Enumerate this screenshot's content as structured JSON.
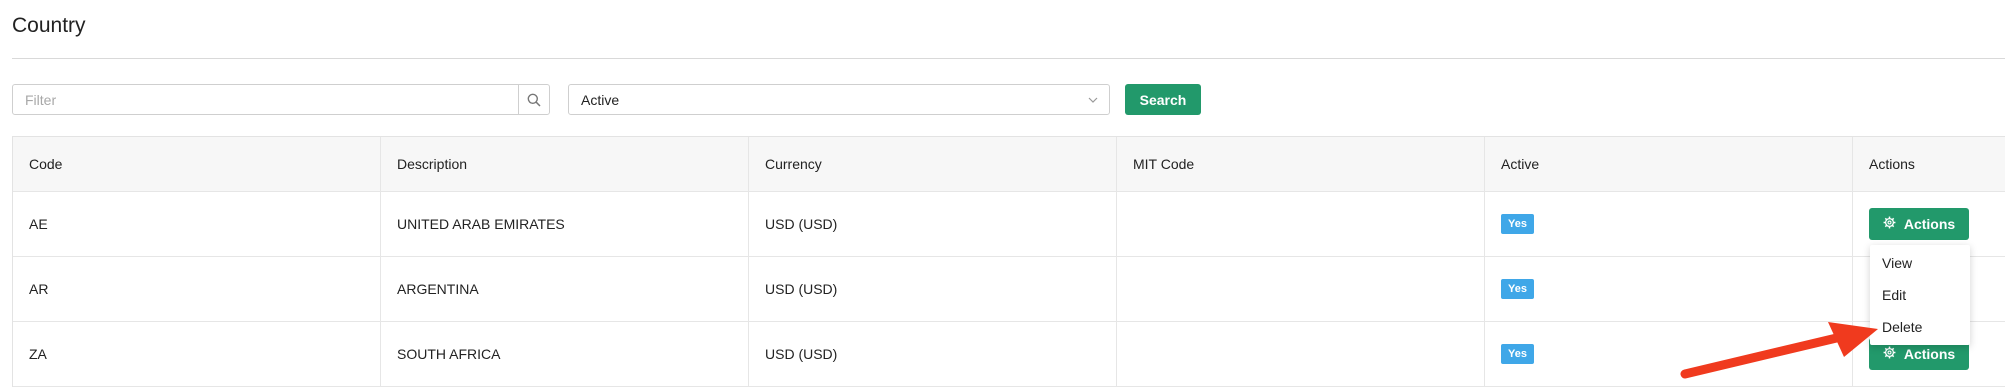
{
  "page": {
    "title": "Country"
  },
  "filter": {
    "placeholder": "Filter",
    "status_value": "Active",
    "search_label": "Search"
  },
  "table": {
    "columns": [
      "Code",
      "Description",
      "Currency",
      "MIT Code",
      "Active",
      "Actions"
    ],
    "rows": [
      {
        "code": "AE",
        "description": "UNITED ARAB EMIRATES",
        "currency": "USD (USD)",
        "mit_code": "",
        "active": "Yes",
        "action_label": "Actions"
      },
      {
        "code": "AR",
        "description": "ARGENTINA",
        "currency": "USD (USD)",
        "mit_code": "",
        "active": "Yes",
        "action_label": "Actions"
      },
      {
        "code": "ZA",
        "description": "SOUTH AFRICA",
        "currency": "USD (USD)",
        "mit_code": "",
        "active": "Yes",
        "action_label": "Actions"
      }
    ]
  },
  "actions_menu": {
    "items": [
      "View",
      "Edit",
      "Delete"
    ]
  },
  "colors": {
    "primary": "#22996b",
    "badge": "#3fa7e8",
    "annotation_arrow": "#f03a1e"
  }
}
